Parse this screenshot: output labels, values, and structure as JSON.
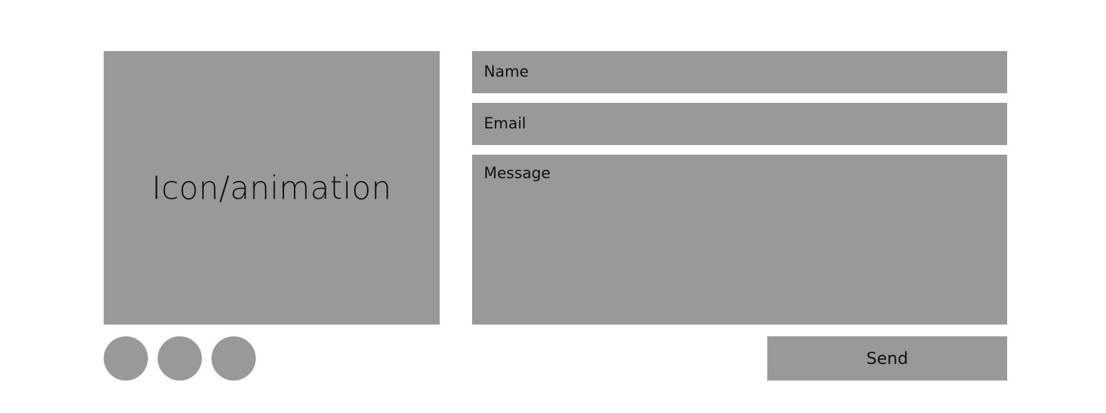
{
  "media": {
    "label": "Icon/animation"
  },
  "form": {
    "name_placeholder": "Name",
    "email_placeholder": "Email",
    "message_placeholder": "Message",
    "send_label": "Send"
  },
  "social": {
    "count": 3
  },
  "colors": {
    "placeholder_gray": "#999999",
    "text": "#111111",
    "background": "#ffffff"
  }
}
